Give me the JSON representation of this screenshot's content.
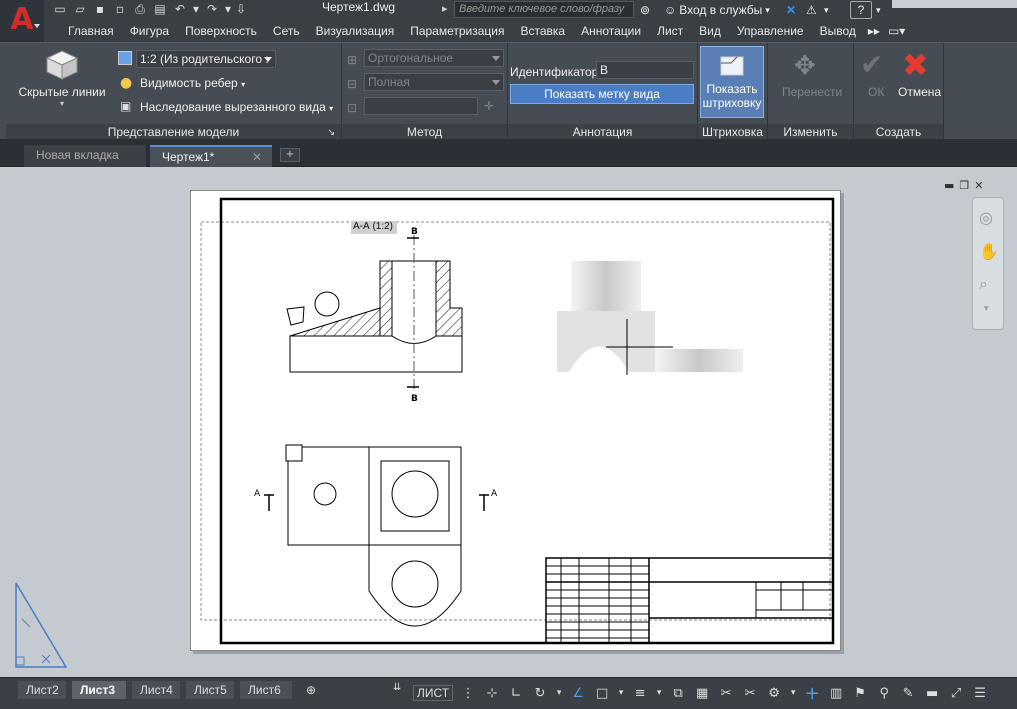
{
  "titlebar": {
    "doc_title": "Чертеж1.dwg",
    "search_placeholder": "Введите ключевое слово/фразу",
    "signin_label": "Вход в службы"
  },
  "menu": {
    "tabs": [
      "Главная",
      "Фигура",
      "Поверхность",
      "Сеть",
      "Визуализация",
      "Параметризация",
      "Вставка",
      "Аннотации",
      "Лист",
      "Вид",
      "Управление",
      "Вывод"
    ]
  },
  "ribbon": {
    "model_view": {
      "title": "Представление модели",
      "hidden_lines_label": "Скрытые линии",
      "scale_value": "1:2 (Из родительского :",
      "edge_visibility_label": "Видимость ребер",
      "cut_inheritance_label": "Наследование вырезанного вида"
    },
    "method": {
      "title": "Метод",
      "projection_value": "Ортогональное",
      "depth_value": "Полная"
    },
    "annotation": {
      "title": "Аннотация",
      "identifier_label": "Идентификатор",
      "identifier_value": "В",
      "show_label_button": "Показать метку вида"
    },
    "hatch": {
      "title": "Штриховка",
      "show_hatch_line1": "Показать",
      "show_hatch_line2": "штриховку"
    },
    "modify": {
      "title": "Изменить",
      "move_label": "Перенести"
    },
    "create": {
      "title": "Создать",
      "ok_label": "ОК",
      "cancel_label": "Отмена"
    }
  },
  "doc_tabs": {
    "new_tab": "Новая вкладка",
    "active_tab": "Чертеж1*"
  },
  "drawing": {
    "section_label": "А-А",
    "section_scale": "(1:2)",
    "cut_label_b": "В",
    "cut_label_a": "А"
  },
  "layout_tabs": [
    "Лист2",
    "Лист3",
    "Лист4",
    "Лист5",
    "Лист6"
  ],
  "active_layout": "Лист3",
  "status": {
    "space_label": "ЛИСТ"
  },
  "colors": {
    "accent_blue": "#4a7dc4",
    "logo_red": "#d12b2b",
    "ribbon_bg": "#464c54"
  }
}
